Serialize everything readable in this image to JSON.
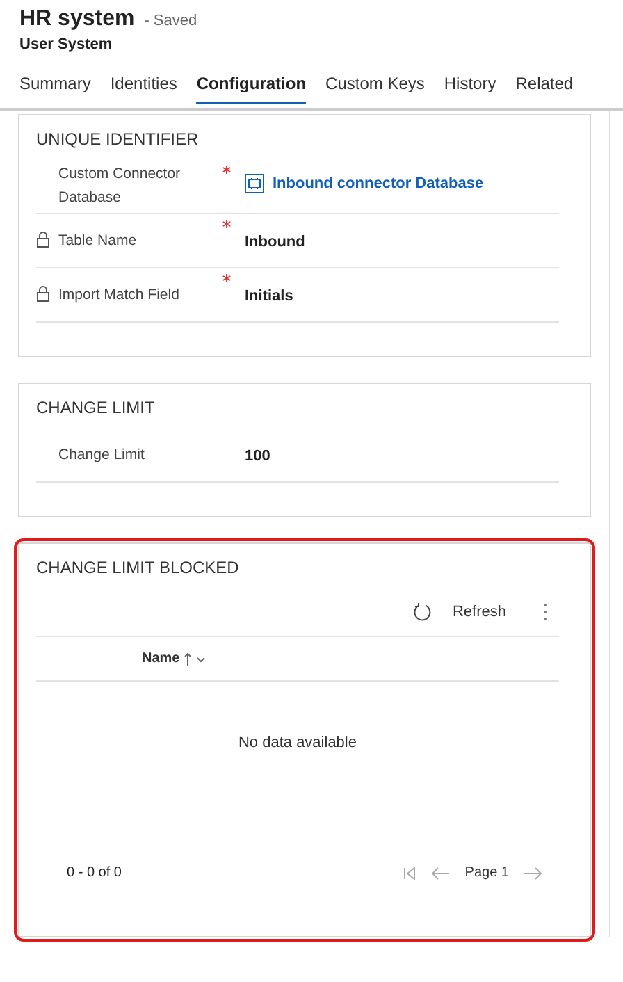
{
  "header": {
    "title": "HR system",
    "status": "- Saved",
    "subtitle": "User System"
  },
  "tabs": [
    {
      "label": "Summary",
      "selected": false
    },
    {
      "label": "Identities",
      "selected": false
    },
    {
      "label": "Configuration",
      "selected": true
    },
    {
      "label": "Custom Keys",
      "selected": false
    },
    {
      "label": "History",
      "selected": false
    },
    {
      "label": "Related",
      "selected": false
    }
  ],
  "sections": [
    {
      "kind": "form",
      "title": "UNIQUE IDENTIFIER",
      "highlighted": false,
      "fields": [
        {
          "label": "Custom Connector Database",
          "locked": false,
          "required": true,
          "value": "Inbound connector Database",
          "kind": "link"
        },
        {
          "label": "Table Name",
          "locked": true,
          "required": true,
          "value": "Inbound",
          "kind": "text"
        },
        {
          "label": "Import Match Field",
          "locked": true,
          "required": true,
          "value": "Initials",
          "kind": "text"
        }
      ]
    },
    {
      "kind": "form",
      "title": "CHANGE LIMIT",
      "highlighted": false,
      "fields": [
        {
          "label": "Change Limit",
          "locked": false,
          "required": false,
          "value": "100",
          "kind": "text"
        }
      ]
    },
    {
      "kind": "grid",
      "title": "CHANGE LIMIT BLOCKED",
      "highlighted": true,
      "toolbar": {
        "refresh": "Refresh"
      },
      "column": "Name",
      "empty": "No data available",
      "range": "0 - 0 of 0",
      "page": "Page 1"
    }
  ]
}
